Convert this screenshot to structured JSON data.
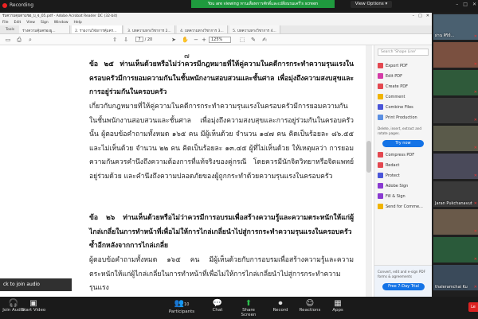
{
  "zoom": {
    "recording_label": "Recording",
    "viewing_banner": "You are viewing ทานเลื่อทการศักดิ์และเปลี่ยนรมเครี่'s screen",
    "view_options": "View Options",
    "join_audio": "ck to join audio",
    "participants_count": "10",
    "toolbar": [
      {
        "label": "Join Audio",
        "icon": "headphones-icon",
        "glyph": "🎧"
      },
      {
        "label": "Start Video",
        "icon": "video-off-icon",
        "glyph": "▣"
      },
      {
        "label": "Participants",
        "icon": "participants-icon",
        "glyph": "👥"
      },
      {
        "label": "Chat",
        "icon": "chat-icon",
        "glyph": "💬"
      },
      {
        "label": "Share Screen",
        "icon": "share-screen-icon",
        "glyph": "⬆"
      },
      {
        "label": "Record",
        "icon": "record-icon",
        "glyph": "⏺"
      },
      {
        "label": "Reactions",
        "icon": "reactions-icon",
        "glyph": "☺"
      },
      {
        "label": "Apps",
        "icon": "apps-icon",
        "glyph": "▦"
      }
    ],
    "leave": "Le",
    "colors": {
      "share_green": "#1f9a3e",
      "leave_red": "#d22222"
    }
  },
  "acrobat": {
    "title": "รับความคุมตามชอ_บ_จ_05.pdf - Adobe Acrobat Reader DC (32-bit)",
    "menu": [
      "File",
      "Edit",
      "View",
      "Sign",
      "Window",
      "Help"
    ],
    "tabs": [
      "Tools",
      "ร่างความคุ้มครองผู...",
      "2. รายงานวิจัยการคุ้มครอง...",
      "3. บทความทางวิชาการ 2...",
      "4. บทความทางวิชาการ 3...",
      "5. บทความทางวิชาการ 4..."
    ],
    "page_current": "7",
    "page_total": "/ 20",
    "zoom_value": "125%",
    "page_label": "๗",
    "paragraphs": [
      "ข้อ ๒๕ ท่านเห็นด้วยหรือไม่ว่าควรมีกฎหมายที่ให้คู่ความในคดีการกระทำความรุนแรงในครอบครัวมีการยอมความกันในชั้นพนักงานสอบสวนและชั้นศาล เพื่อมุ่งถึงความสงบสุขและการอยู่ร่วมกันในครอบครัว",
      "เกี่ยวกับกฎหมายที่ให้คู่ความในคดีการกระทำความรุนแรงในครอบครัวมีการยอมความกันในชั้นพนักงานสอบสวนและชั้นศาล เพื่อมุ่งถึงความสงบสุขและการอยู่ร่วมกันในครอบครัวนั้น ผู้ตอบข้อคำถามทั้งหมด ๑๖๕ คน มีผู้เห็นด้วย จำนวน ๑๔๗ คน คิดเป็นร้อยละ ๘๖.๕๕ และไม่เห็นด้วย จำนวน ๒๒ คน คิดเป็นร้อยละ ๑๓.๔๕ ผู้ที่ไม่เห็นด้วย ให้เหตุผลว่า การยอมความกันควรคำนึงถึงความต้องการที่แท้จริงของคู่กรณี โดยควรมีนักจิตวิทยาหรือจิตแพทย์อยู่ร่วมด้วย และคำนึงถึงความปลอดภัยของผู้ถูกกระทำด้วยความรุนแรงในครอบครัว",
      "ข้อ ๒๖ ท่านเห็นด้วยหรือไม่ว่าควรมีการอบรมเพื่อสร้างความรู้และความตระหนักให้แก่ผู้ไกล่เกลี่ยในการทำหน้าที่เพื่อไม่ให้การไกล่เกลี่ยนำไปสู่การกระทำความรุนแรงในครอบครัวซ้ำอีกหลังจากการไกล่เกลี่ย",
      "ผู้ตอบข้อคำถามทั้งหมด ๑๖๕ คน มีผู้เห็นด้วยกับการอบรมเพื่อสร้างความรู้และความตระหนักให้แก่ผู้ไกล่เกลี่ยในการทำหน้าที่เพื่อไม่ให้การไกล่เกลี่ยนำไปสู่การกระทำความรุนแรง"
    ],
    "search_placeholder": "Search 'Shape Line'",
    "tools": [
      {
        "label": "Export PDF",
        "color": "#e34850"
      },
      {
        "label": "Edit PDF",
        "color": "#d43ba7"
      },
      {
        "label": "Create PDF",
        "color": "#e34850"
      },
      {
        "label": "Comment",
        "color": "#f0b400"
      },
      {
        "label": "Combine Files",
        "color": "#4a55d8"
      },
      {
        "label": "Print Production",
        "color": "#5b8fe2"
      }
    ],
    "promo_text": "Delete, insert, extract and rotate pages.",
    "try_now": "Try now",
    "tools2": [
      {
        "label": "Compress PDF",
        "color": "#e34850"
      },
      {
        "label": "Redact",
        "color": "#e34850"
      },
      {
        "label": "Protect",
        "color": "#4a55d8"
      },
      {
        "label": "Adobe Sign",
        "color": "#8a3bd1"
      },
      {
        "label": "Fill & Sign",
        "color": "#8a3bd1"
      },
      {
        "label": "Send for Comme...",
        "color": "#f0b400"
      }
    ],
    "promo2_text": "Convert, edit and e-sign PDF forms & agreements",
    "free_trial": "Free 7-Day Trial"
  },
  "participants": [
    {
      "name": "ผ่าน ศิริย์...",
      "bg": "#4a6070"
    },
    {
      "name": "",
      "bg": "#7a5040"
    },
    {
      "name": "",
      "bg": "#2f5a3a"
    },
    {
      "name": "",
      "bg": "#3a3a3a"
    },
    {
      "name": "",
      "bg": "#5a5a4a"
    },
    {
      "name": "",
      "bg": "#4a4a5a"
    },
    {
      "name": "Jaran Pukchanavut",
      "bg": "#3a3a3a"
    },
    {
      "name": "",
      "bg": "#6a5a4a"
    },
    {
      "name": "",
      "bg": "#2a5a3a"
    },
    {
      "name": "thaleramchai Ku",
      "bg": "#3a4a5a"
    }
  ]
}
